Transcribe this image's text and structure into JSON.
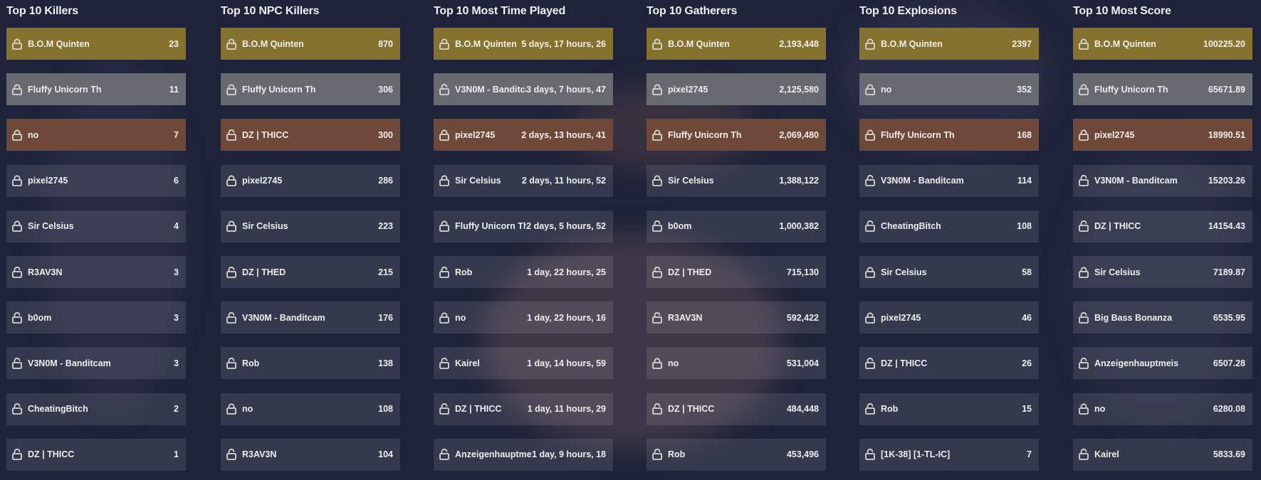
{
  "theme": {
    "background": "#1f2339",
    "gold": "#86722f",
    "silver": "#686a72",
    "bronze": "#6e4939"
  },
  "icons": {
    "locked": "lock-icon",
    "unlocked": "unlock-icon"
  },
  "boards": [
    {
      "title": "Top 10 Killers",
      "rows": [
        {
          "name": "B.O.M Quinten",
          "value": "23",
          "locked": true
        },
        {
          "name": "Fluffy Unicorn Th",
          "value": "11",
          "locked": true
        },
        {
          "name": "no",
          "value": "7",
          "locked": true
        },
        {
          "name": "pixel2745",
          "value": "6",
          "locked": true
        },
        {
          "name": "Sir Celsius",
          "value": "4",
          "locked": true
        },
        {
          "name": "R3AV3N",
          "value": "3",
          "locked": false
        },
        {
          "name": "b0om",
          "value": "3",
          "locked": false
        },
        {
          "name": "V3N0M - Banditcam",
          "value": "3",
          "locked": false
        },
        {
          "name": "CheatingBitch",
          "value": "2",
          "locked": false
        },
        {
          "name": "DZ | THICC",
          "value": "1",
          "locked": false
        }
      ]
    },
    {
      "title": "Top 10 NPC Killers",
      "rows": [
        {
          "name": "B.O.M Quinten",
          "value": "870",
          "locked": true
        },
        {
          "name": "Fluffy Unicorn Th",
          "value": "306",
          "locked": true
        },
        {
          "name": "DZ | THICC",
          "value": "300",
          "locked": false
        },
        {
          "name": "pixel2745",
          "value": "286",
          "locked": true
        },
        {
          "name": "Sir Celsius",
          "value": "223",
          "locked": true
        },
        {
          "name": "DZ | THED",
          "value": "215",
          "locked": false
        },
        {
          "name": "V3N0M - Banditcam",
          "value": "176",
          "locked": false
        },
        {
          "name": "Rob",
          "value": "138",
          "locked": false
        },
        {
          "name": "no",
          "value": "108",
          "locked": true
        },
        {
          "name": "R3AV3N",
          "value": "104",
          "locked": false
        }
      ]
    },
    {
      "title": "Top 10 Most Time Played",
      "rows": [
        {
          "name": "B.O.M Quinten",
          "value": "5 days, 17 hours, 26",
          "locked": true
        },
        {
          "name": "V3N0M - Banditcam",
          "value": "3 days, 7 hours, 47",
          "locked": false
        },
        {
          "name": "pixel2745",
          "value": "2 days, 13 hours, 41",
          "locked": true
        },
        {
          "name": "Sir Celsius",
          "value": "2 days, 11 hours, 52",
          "locked": true
        },
        {
          "name": "Fluffy Unicorn Th",
          "value": "2 days, 5 hours, 52",
          "locked": true
        },
        {
          "name": "Rob",
          "value": "1 day, 22 hours, 25",
          "locked": false
        },
        {
          "name": "no",
          "value": "1 day, 22 hours, 16",
          "locked": true
        },
        {
          "name": "Kairel",
          "value": "1 day, 14 hours, 59",
          "locked": false
        },
        {
          "name": "DZ | THICC",
          "value": "1 day, 11 hours, 29",
          "locked": false
        },
        {
          "name": "Anzeigenhauptmeis",
          "value": "1 day, 9 hours, 18",
          "locked": false
        }
      ]
    },
    {
      "title": "Top 10 Gatherers",
      "rows": [
        {
          "name": "B.O.M Quinten",
          "value": "2,193,448",
          "locked": true
        },
        {
          "name": "pixel2745",
          "value": "2,125,580",
          "locked": true
        },
        {
          "name": "Fluffy Unicorn Th",
          "value": "2,069,480",
          "locked": true
        },
        {
          "name": "Sir Celsius",
          "value": "1,388,122",
          "locked": true
        },
        {
          "name": "b0om",
          "value": "1,000,382",
          "locked": false
        },
        {
          "name": "DZ | THED",
          "value": "715,130",
          "locked": false
        },
        {
          "name": "R3AV3N",
          "value": "592,422",
          "locked": false
        },
        {
          "name": "no",
          "value": "531,004",
          "locked": true
        },
        {
          "name": "DZ | THICC",
          "value": "484,448",
          "locked": false
        },
        {
          "name": "Rob",
          "value": "453,496",
          "locked": false
        }
      ]
    },
    {
      "title": "Top 10 Explosions",
      "rows": [
        {
          "name": "B.O.M Quinten",
          "value": "2397",
          "locked": true
        },
        {
          "name": "no",
          "value": "352",
          "locked": true
        },
        {
          "name": "Fluffy Unicorn Th",
          "value": "168",
          "locked": true
        },
        {
          "name": "V3N0M - Banditcam",
          "value": "114",
          "locked": false
        },
        {
          "name": "CheatingBitch",
          "value": "108",
          "locked": false
        },
        {
          "name": "Sir Celsius",
          "value": "58",
          "locked": true
        },
        {
          "name": "pixel2745",
          "value": "46",
          "locked": true
        },
        {
          "name": "DZ | THICC",
          "value": "26",
          "locked": false
        },
        {
          "name": "Rob",
          "value": "15",
          "locked": false
        },
        {
          "name": "[1K-38] [1-TL-IC]",
          "value": "7",
          "locked": false
        }
      ]
    },
    {
      "title": "Top 10 Most Score",
      "rows": [
        {
          "name": "B.O.M Quinten",
          "value": "100225.20",
          "locked": true
        },
        {
          "name": "Fluffy Unicorn Th",
          "value": "65671.89",
          "locked": true
        },
        {
          "name": "pixel2745",
          "value": "18990.51",
          "locked": true
        },
        {
          "name": "V3N0M - Banditcam",
          "value": "15203.26",
          "locked": false
        },
        {
          "name": "DZ | THICC",
          "value": "14154.43",
          "locked": false
        },
        {
          "name": "Sir Celsius",
          "value": "7189.87",
          "locked": true
        },
        {
          "name": "Big Bass Bonanza",
          "value": "6535.95",
          "locked": false
        },
        {
          "name": "Anzeigenhauptmeis",
          "value": "6507.28",
          "locked": false
        },
        {
          "name": "no",
          "value": "6280.08",
          "locked": true
        },
        {
          "name": "Kairel",
          "value": "5833.69",
          "locked": false
        }
      ]
    }
  ]
}
